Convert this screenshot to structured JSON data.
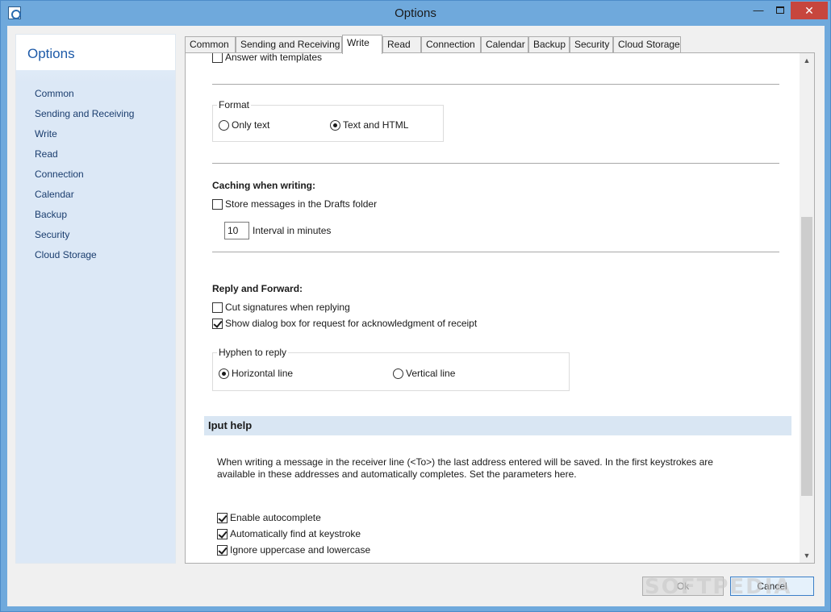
{
  "window": {
    "title": "Options",
    "minimize_glyph": "—",
    "close_glyph": "✕"
  },
  "sidebar": {
    "title": "Options",
    "items": [
      {
        "label": "Common"
      },
      {
        "label": "Sending and Receiving"
      },
      {
        "label": "Write"
      },
      {
        "label": "Read"
      },
      {
        "label": "Connection"
      },
      {
        "label": "Calendar"
      },
      {
        "label": "Backup"
      },
      {
        "label": "Security"
      },
      {
        "label": "Cloud Storage"
      }
    ]
  },
  "tabs": [
    {
      "label": "Common",
      "active": false
    },
    {
      "label": "Sending and Receiving",
      "active": false
    },
    {
      "label": "Write",
      "active": true
    },
    {
      "label": "Read",
      "active": false
    },
    {
      "label": "Connection",
      "active": false
    },
    {
      "label": "Calendar",
      "active": false
    },
    {
      "label": "Backup",
      "active": false
    },
    {
      "label": "Security",
      "active": false
    },
    {
      "label": "Cloud Storage",
      "active": false
    }
  ],
  "write": {
    "answer_templates": {
      "label": "Answer with templates",
      "checked": false
    },
    "format": {
      "legend": "Format",
      "options": [
        {
          "label": "Only text",
          "selected": false
        },
        {
          "label": "Text and HTML",
          "selected": true
        }
      ]
    },
    "caching": {
      "heading": "Caching when writing:",
      "store_drafts": {
        "label": "Store messages in the Drafts folder",
        "checked": false
      },
      "interval_value": "10",
      "interval_label": "Interval in minutes"
    },
    "reply_forward": {
      "heading": "Reply and Forward:",
      "cut_signatures": {
        "label": "Cut signatures when replying",
        "checked": false
      },
      "show_dialog": {
        "label": "Show dialog box for request for acknowledgment of receipt",
        "checked": true
      }
    },
    "hyphen": {
      "legend": "Hyphen to reply",
      "options": [
        {
          "label": "Horizontal line",
          "selected": true
        },
        {
          "label": "Vertical line",
          "selected": false
        }
      ]
    },
    "input_help": {
      "heading": "Iput help",
      "description": "When writing a message in the receiver line (<To>) the last address entered will be saved. In the first keystrokes are available in these addresses and automatically completes. Set the parameters here.",
      "enable_autocomplete": {
        "label": "Enable autocomplete",
        "checked": true
      },
      "auto_find": {
        "label": "Automatically find at keystroke",
        "checked": true
      },
      "ignore_case": {
        "label": "Ignore uppercase and lowercase",
        "checked": true
      }
    }
  },
  "buttons": {
    "ok": "Ok",
    "cancel": "Cancel"
  },
  "scrollbar": {
    "up_glyph": "▲",
    "down_glyph": "▼"
  },
  "watermark": "SOFTPEDIA",
  "colors": {
    "titlebar": "#6fa9dc",
    "close_button": "#c7463d",
    "sidebar_title": "#1d5aa8",
    "section_header": "#d9e6f3"
  }
}
